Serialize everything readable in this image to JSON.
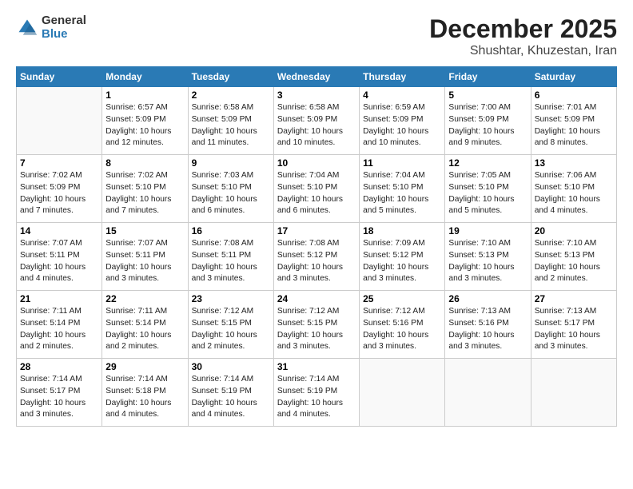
{
  "logo": {
    "general": "General",
    "blue": "Blue"
  },
  "title": "December 2025",
  "subtitle": "Shushtar, Khuzestan, Iran",
  "days_of_week": [
    "Sunday",
    "Monday",
    "Tuesday",
    "Wednesday",
    "Thursday",
    "Friday",
    "Saturday"
  ],
  "weeks": [
    [
      {
        "day": "",
        "info": ""
      },
      {
        "day": "1",
        "info": "Sunrise: 6:57 AM\nSunset: 5:09 PM\nDaylight: 10 hours\nand 12 minutes."
      },
      {
        "day": "2",
        "info": "Sunrise: 6:58 AM\nSunset: 5:09 PM\nDaylight: 10 hours\nand 11 minutes."
      },
      {
        "day": "3",
        "info": "Sunrise: 6:58 AM\nSunset: 5:09 PM\nDaylight: 10 hours\nand 10 minutes."
      },
      {
        "day": "4",
        "info": "Sunrise: 6:59 AM\nSunset: 5:09 PM\nDaylight: 10 hours\nand 10 minutes."
      },
      {
        "day": "5",
        "info": "Sunrise: 7:00 AM\nSunset: 5:09 PM\nDaylight: 10 hours\nand 9 minutes."
      },
      {
        "day": "6",
        "info": "Sunrise: 7:01 AM\nSunset: 5:09 PM\nDaylight: 10 hours\nand 8 minutes."
      }
    ],
    [
      {
        "day": "7",
        "info": "Sunrise: 7:02 AM\nSunset: 5:09 PM\nDaylight: 10 hours\nand 7 minutes."
      },
      {
        "day": "8",
        "info": "Sunrise: 7:02 AM\nSunset: 5:10 PM\nDaylight: 10 hours\nand 7 minutes."
      },
      {
        "day": "9",
        "info": "Sunrise: 7:03 AM\nSunset: 5:10 PM\nDaylight: 10 hours\nand 6 minutes."
      },
      {
        "day": "10",
        "info": "Sunrise: 7:04 AM\nSunset: 5:10 PM\nDaylight: 10 hours\nand 6 minutes."
      },
      {
        "day": "11",
        "info": "Sunrise: 7:04 AM\nSunset: 5:10 PM\nDaylight: 10 hours\nand 5 minutes."
      },
      {
        "day": "12",
        "info": "Sunrise: 7:05 AM\nSunset: 5:10 PM\nDaylight: 10 hours\nand 5 minutes."
      },
      {
        "day": "13",
        "info": "Sunrise: 7:06 AM\nSunset: 5:10 PM\nDaylight: 10 hours\nand 4 minutes."
      }
    ],
    [
      {
        "day": "14",
        "info": "Sunrise: 7:07 AM\nSunset: 5:11 PM\nDaylight: 10 hours\nand 4 minutes."
      },
      {
        "day": "15",
        "info": "Sunrise: 7:07 AM\nSunset: 5:11 PM\nDaylight: 10 hours\nand 3 minutes."
      },
      {
        "day": "16",
        "info": "Sunrise: 7:08 AM\nSunset: 5:11 PM\nDaylight: 10 hours\nand 3 minutes."
      },
      {
        "day": "17",
        "info": "Sunrise: 7:08 AM\nSunset: 5:12 PM\nDaylight: 10 hours\nand 3 minutes."
      },
      {
        "day": "18",
        "info": "Sunrise: 7:09 AM\nSunset: 5:12 PM\nDaylight: 10 hours\nand 3 minutes."
      },
      {
        "day": "19",
        "info": "Sunrise: 7:10 AM\nSunset: 5:13 PM\nDaylight: 10 hours\nand 3 minutes."
      },
      {
        "day": "20",
        "info": "Sunrise: 7:10 AM\nSunset: 5:13 PM\nDaylight: 10 hours\nand 2 minutes."
      }
    ],
    [
      {
        "day": "21",
        "info": "Sunrise: 7:11 AM\nSunset: 5:14 PM\nDaylight: 10 hours\nand 2 minutes."
      },
      {
        "day": "22",
        "info": "Sunrise: 7:11 AM\nSunset: 5:14 PM\nDaylight: 10 hours\nand 2 minutes."
      },
      {
        "day": "23",
        "info": "Sunrise: 7:12 AM\nSunset: 5:15 PM\nDaylight: 10 hours\nand 2 minutes."
      },
      {
        "day": "24",
        "info": "Sunrise: 7:12 AM\nSunset: 5:15 PM\nDaylight: 10 hours\nand 3 minutes."
      },
      {
        "day": "25",
        "info": "Sunrise: 7:12 AM\nSunset: 5:16 PM\nDaylight: 10 hours\nand 3 minutes."
      },
      {
        "day": "26",
        "info": "Sunrise: 7:13 AM\nSunset: 5:16 PM\nDaylight: 10 hours\nand 3 minutes."
      },
      {
        "day": "27",
        "info": "Sunrise: 7:13 AM\nSunset: 5:17 PM\nDaylight: 10 hours\nand 3 minutes."
      }
    ],
    [
      {
        "day": "28",
        "info": "Sunrise: 7:14 AM\nSunset: 5:17 PM\nDaylight: 10 hours\nand 3 minutes."
      },
      {
        "day": "29",
        "info": "Sunrise: 7:14 AM\nSunset: 5:18 PM\nDaylight: 10 hours\nand 4 minutes."
      },
      {
        "day": "30",
        "info": "Sunrise: 7:14 AM\nSunset: 5:19 PM\nDaylight: 10 hours\nand 4 minutes."
      },
      {
        "day": "31",
        "info": "Sunrise: 7:14 AM\nSunset: 5:19 PM\nDaylight: 10 hours\nand 4 minutes."
      },
      {
        "day": "",
        "info": ""
      },
      {
        "day": "",
        "info": ""
      },
      {
        "day": "",
        "info": ""
      }
    ]
  ]
}
